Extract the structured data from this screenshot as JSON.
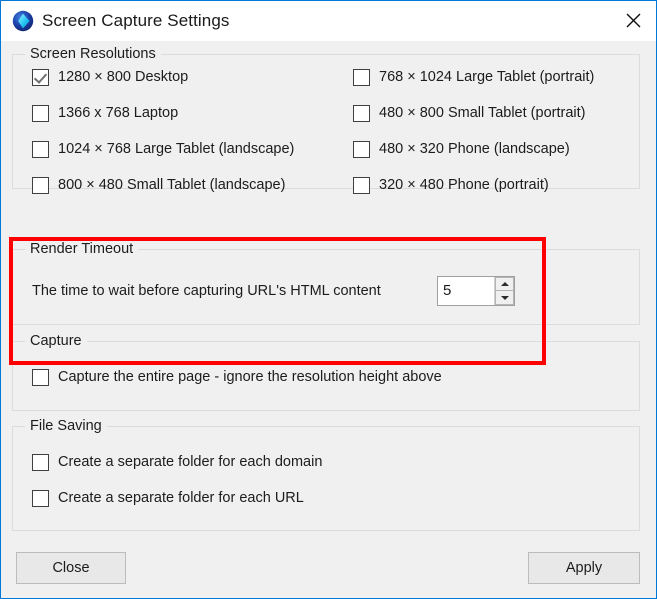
{
  "window": {
    "title": "Screen Capture Settings",
    "app_icon": "blue-diamond-icon",
    "close_icon": "close-icon",
    "border_color": "#0078d7"
  },
  "groups": {
    "screen_resolutions": {
      "title": "Screen Resolutions",
      "items_left": [
        {
          "label": "1280 × 800 Desktop",
          "checked": true
        },
        {
          "label": "1366 x 768 Laptop",
          "checked": false
        },
        {
          "label": "1024 × 768 Large Tablet (landscape)",
          "checked": false
        },
        {
          "label": "800 × 480 Small Tablet (landscape)",
          "checked": false
        }
      ],
      "items_right": [
        {
          "label": "768 × 1024 Large Tablet (portrait)",
          "checked": false
        },
        {
          "label": "480 × 800 Small Tablet (portrait)",
          "checked": false
        },
        {
          "label": "480 × 320 Phone (landscape)",
          "checked": false
        },
        {
          "label": "320 × 480 Phone (portrait)",
          "checked": false
        }
      ]
    },
    "render_timeout": {
      "title": "Render Timeout",
      "description": "The time to wait before capturing URL's HTML content",
      "value": "5",
      "highlight_color": "#ff0000"
    },
    "capture": {
      "title": "Capture",
      "items": [
        {
          "label": "Capture the entire page - ignore the resolution height above",
          "checked": false
        }
      ]
    },
    "file_saving": {
      "title": "File Saving",
      "items": [
        {
          "label": "Create a separate folder for each domain",
          "checked": false
        },
        {
          "label": "Create a separate folder for each URL",
          "checked": false
        }
      ]
    }
  },
  "footer": {
    "close_label": "Close",
    "apply_label": "Apply"
  }
}
